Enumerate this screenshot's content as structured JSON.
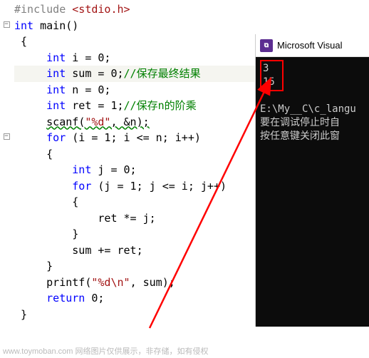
{
  "code": {
    "l01_pre": "#include ",
    "l01_inc": "<stdio.h>",
    "l02_kw": "int",
    "l02_rest": " main()",
    "l03": " {",
    "l04_kw": "int",
    "l04_rest": " i = 0;",
    "l05_kw": "int",
    "l05_rest": " sum = 0;",
    "l05_comment": "//保存最终结果",
    "l06_kw": "int",
    "l06_rest": " n = 0;",
    "l07_kw": "int",
    "l07_rest": " ret = 1;",
    "l07_comment": "//保存n的阶乘",
    "l08_scanf": "scanf",
    "l08_open": "(",
    "l08_str": "\"%d\"",
    "l08_rest": ", &n);",
    "l09_kw": "for",
    "l09_rest": " (i = 1; i <= n; i++)",
    "l10": "     {",
    "l11_kw": "int",
    "l11_rest": " j = 0;",
    "l12_kw": "for",
    "l12_rest": " (j = 1; j <= i; j++)",
    "l13": "         {",
    "l14": "             ret *= j;",
    "l15": "         }",
    "l16": "         sum += ret;",
    "l17": "     }",
    "l18_fn": "printf",
    "l18_open": "(",
    "l18_str": "\"%d\\n\"",
    "l18_rest": ", sum);",
    "l19_kw": "return",
    "l19_rest": " 0;",
    "l20": " }"
  },
  "console": {
    "title": "Microsoft Visual",
    "input": "3",
    "output": "15",
    "path": "E:\\My__C\\c_langu",
    "msg1": "要在调试停止时自",
    "msg2": "按任意键关闭此窗"
  },
  "watermark": "www.toymoban.com  网络图片仅供展示，非存储，如有侵权"
}
